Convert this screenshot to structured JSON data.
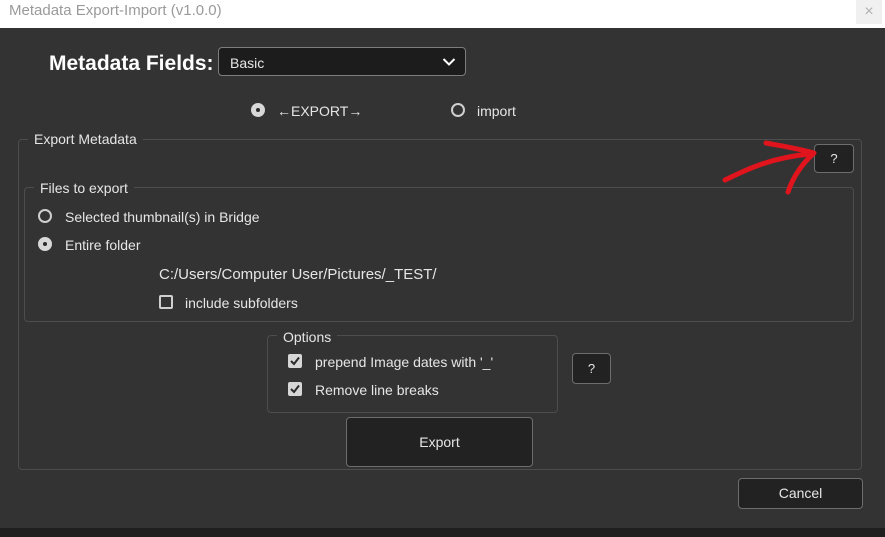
{
  "window": {
    "title": "Metadata Export-Import (v1.0.0)",
    "close_glyph": "×"
  },
  "metadata_fields": {
    "label": "Metadata Fields:",
    "selected": "Basic"
  },
  "mode": {
    "export_label": "←EXPORT→",
    "import_label": "import",
    "selected": "export"
  },
  "export_panel": {
    "title": "Export Metadata",
    "help_label": "?",
    "files_to_export": {
      "title": "Files to export",
      "options": [
        "Selected thumbnail(s) in Bridge",
        "Entire folder"
      ],
      "selected_index": 1,
      "folder_path": "C:/Users/Computer User/Pictures/_TEST/",
      "include_subfolders_label": "include subfolders",
      "include_subfolders_checked": false
    },
    "options": {
      "title": "Options",
      "items": [
        {
          "label": "prepend Image dates with '_'",
          "checked": true
        },
        {
          "label": "Remove line breaks",
          "checked": true
        }
      ],
      "help_label": "?"
    },
    "export_button": "Export"
  },
  "cancel_button": "Cancel",
  "annotation": {
    "color": "#e0141c",
    "icon": "arrow-annotation-icon"
  },
  "colors": {
    "background": "#333333",
    "titlebar": "#ffffff",
    "control_bg": "#222222"
  }
}
